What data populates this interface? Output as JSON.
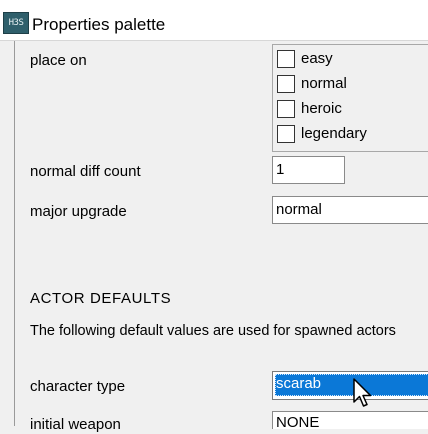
{
  "window": {
    "icon_text": "H3S",
    "title": "Properties palette"
  },
  "properties": {
    "place_on": {
      "label": "place on",
      "options": [
        {
          "label": "easy",
          "checked": false
        },
        {
          "label": "normal",
          "checked": false
        },
        {
          "label": "heroic",
          "checked": false
        },
        {
          "label": "legendary",
          "checked": false
        }
      ]
    },
    "normal_diff_count": {
      "label": "normal diff count",
      "value": "1"
    },
    "major_upgrade": {
      "label": "major upgrade",
      "value": "normal"
    }
  },
  "actor_defaults": {
    "heading": "ACTOR DEFAULTS",
    "description": "The following default values are used for spawned actors",
    "character_type": {
      "label": "character type",
      "value": "scarab"
    },
    "initial_weapon": {
      "label": "initial weapon",
      "value": "NONE"
    }
  },
  "colors": {
    "selection": "#0b78d7",
    "background": "#f0f0f0",
    "icon_bg": "#2f5f6b"
  },
  "icons": [
    "app-icon",
    "mouse-pointer-icon"
  ]
}
